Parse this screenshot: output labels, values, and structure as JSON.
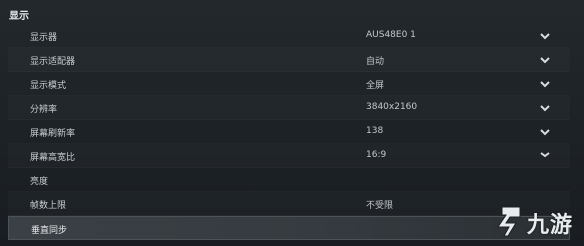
{
  "section": {
    "title": "显示"
  },
  "settings": [
    {
      "label": "显示器",
      "value": "AUS48E0 1",
      "chevron": true
    },
    {
      "label": "显示适配器",
      "value": "自动",
      "chevron": true
    },
    {
      "label": "显示模式",
      "value": "全屏",
      "chevron": true
    },
    {
      "label": "分辨率",
      "value": "3840x2160",
      "chevron": true
    },
    {
      "label": "屏幕刷新率",
      "value": "138",
      "chevron": true
    },
    {
      "label": "屏幕高宽比",
      "value": "16:9",
      "chevron": true
    },
    {
      "label": "亮度",
      "value": "",
      "chevron": false
    },
    {
      "label": "帧数上限",
      "value": "不受限",
      "chevron": false
    },
    {
      "label": "垂直同步",
      "value": "",
      "chevron": false,
      "selected": true
    }
  ],
  "watermark": {
    "text": "九游",
    "icon": "jiuyou-logo-icon"
  },
  "colors": {
    "background": "#1d2226",
    "text": "#d6d9dc",
    "selected_row": "#3a4045"
  }
}
